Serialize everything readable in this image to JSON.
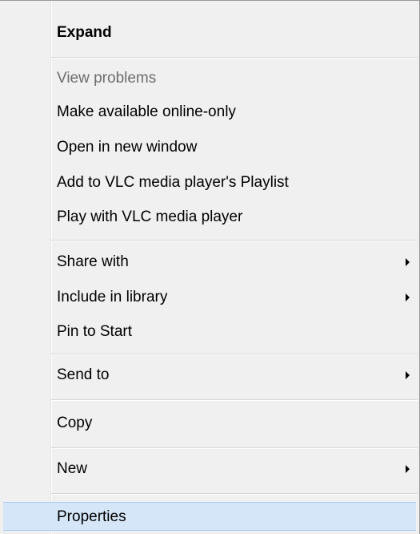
{
  "context_menu": {
    "items": [
      {
        "label": "Expand"
      },
      {
        "label": "View problems"
      },
      {
        "label": "Make available online-only"
      },
      {
        "label": "Open in new window"
      },
      {
        "label": "Add to VLC media player's Playlist"
      },
      {
        "label": "Play with VLC media player"
      },
      {
        "label": "Share with"
      },
      {
        "label": "Include in library"
      },
      {
        "label": "Pin to Start"
      },
      {
        "label": "Send to"
      },
      {
        "label": "Copy"
      },
      {
        "label": "New"
      },
      {
        "label": "Properties"
      }
    ],
    "hover_color": "#d4e6f8",
    "disabled_color": "#6d6d6d"
  }
}
